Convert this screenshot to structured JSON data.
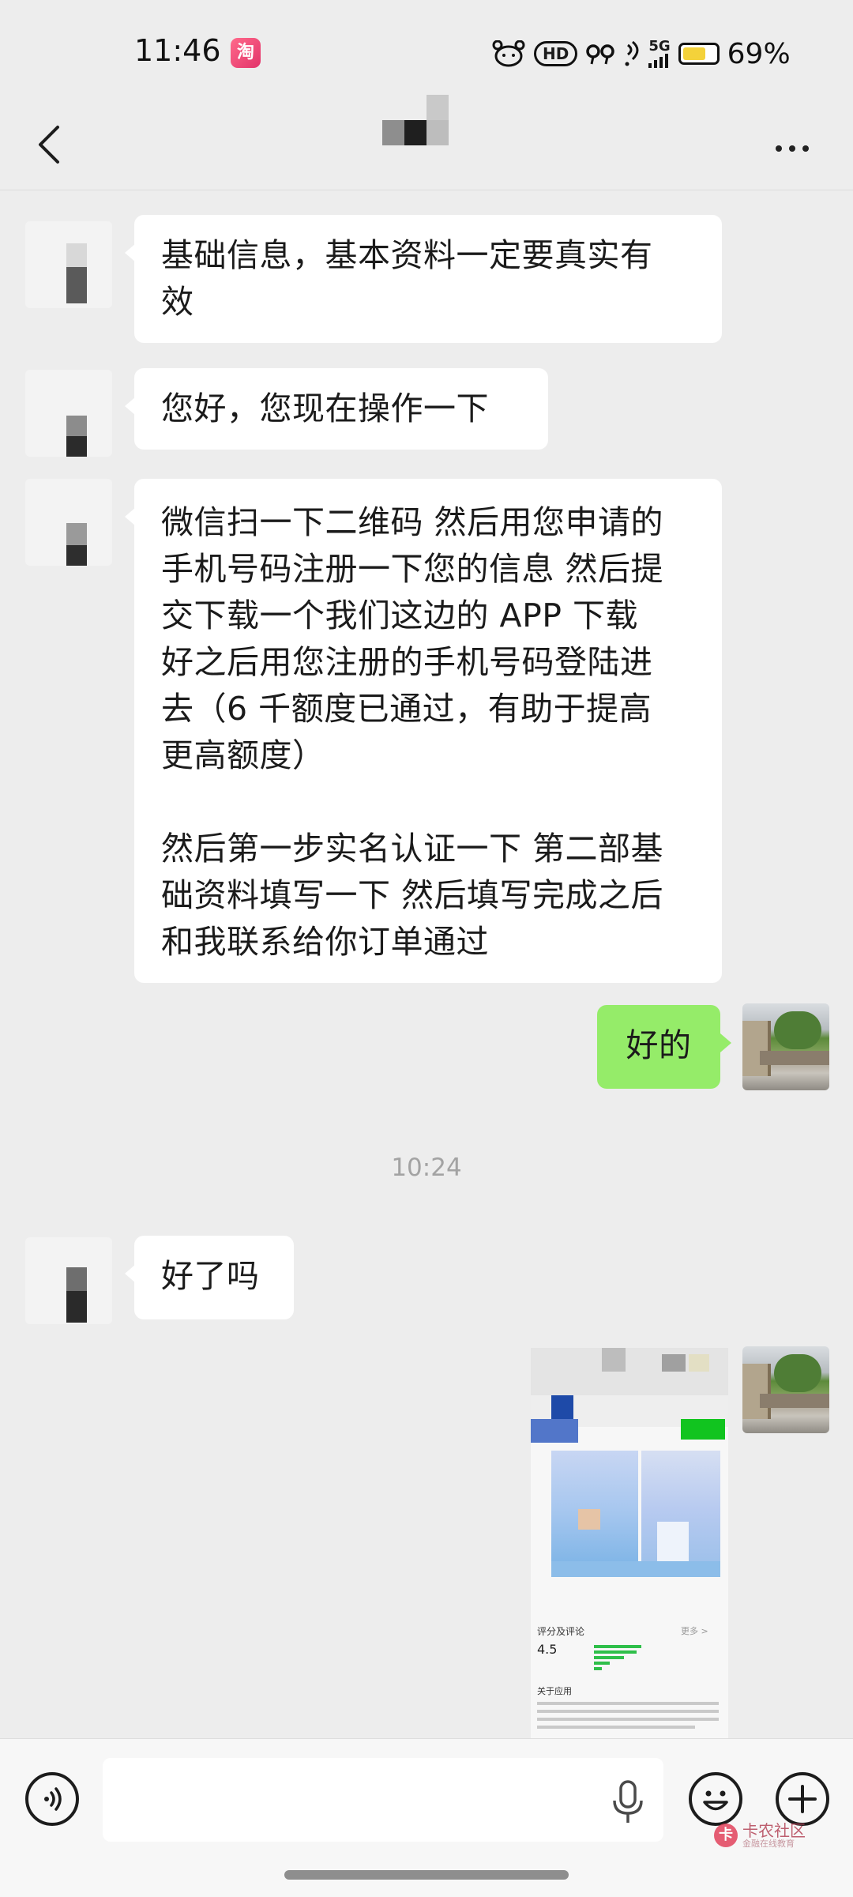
{
  "status_bar": {
    "time": "11:46",
    "taobao_icon_glyph": "淘",
    "network": "5G",
    "battery_percent": 69,
    "battery_text": "69%"
  },
  "header": {
    "name": "",
    "more_icon": "more-dots-icon",
    "back_icon": "chevron-left-icon"
  },
  "messages": [
    {
      "side": "left",
      "text": "基础信息，基本资料一定要真实有\n效"
    },
    {
      "side": "left",
      "text": "您好，您现在操作一下"
    },
    {
      "side": "left",
      "text": "微信扫一下二维码 然后用您申请的\n手机号码注册一下您的信息 然后提\n交下载一个我们这边的 APP 下载\n好之后用您注册的手机号码登陆进\n去（6 千额度已通过，有助于提高\n更高额度）\n\n然后第一步实名认证一下 第二部基\n础资料填写一下 然后填写完成之后\n和我联系给你订单通过"
    },
    {
      "side": "right",
      "text": "好的"
    },
    {
      "side": "left",
      "text": "好了吗"
    }
  ],
  "time_divider": "10:24",
  "image_message": {
    "rating_title": "评分及评论",
    "rating_more": "更多 >",
    "rating_value": "4.5",
    "about_title": "关于应用"
  },
  "input_bar": {
    "placeholder": "",
    "voice_icon": "voice-icon",
    "mic_icon": "microphone-icon",
    "emoji_icon": "emoji-icon",
    "plus_icon": "plus-icon"
  },
  "watermark": {
    "title": "卡农社区",
    "subtitle": "金融在线教育"
  },
  "colors": {
    "background": "#ededed",
    "bubble_self": "#95ec69",
    "bubble_other": "#ffffff"
  }
}
